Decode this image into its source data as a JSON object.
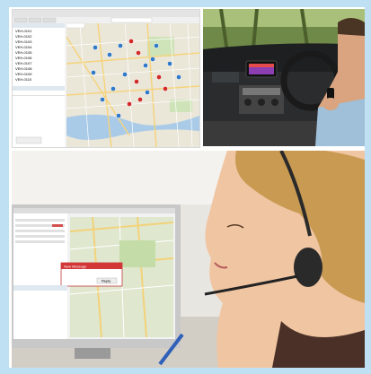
{
  "screenshot_panel": {
    "tab_label": "Map",
    "list_rows": [
      "VEH-0101",
      "VEH-0102",
      "VEH-0103",
      "VEH-0104",
      "VEH-0105",
      "VEH-0106",
      "VEH-0107",
      "VEH-0108",
      "VEH-0109",
      "VEH-0110"
    ],
    "bottom_button": "Send Message"
  },
  "monitor": {
    "popup_title": "New Message",
    "popup_button": "Reply"
  },
  "colors": {
    "frame": "#bfe0f3",
    "map_land": "#eae6d8",
    "map_water": "#a9cbe8",
    "marker_blue": "#2f79c9",
    "marker_red": "#d32a2a"
  }
}
